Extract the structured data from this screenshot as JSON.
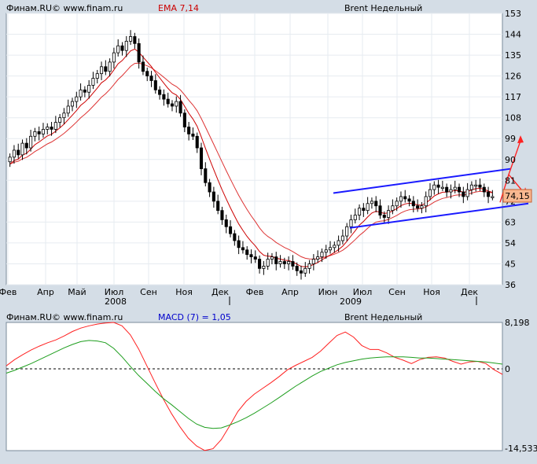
{
  "colors": {
    "background": "#d4dde6",
    "plot_bg": "#ffffff",
    "candle_up": "#ffffff",
    "candle_down": "#000000",
    "ema_fast": "#cc0000",
    "ema_slow": "#dd3333",
    "channel": "#1a1aff",
    "forecast": "#ff2222",
    "price_tag": "#f8b890",
    "macd_line": "#ff2020",
    "signal_line": "#1e9e1e",
    "grid": "#e6ebf0",
    "ema_label": "#cc0000",
    "macd_label": "#0000cc"
  },
  "chart_data": [
    {
      "type": "candlestick",
      "header": {
        "source": "Финам.RU© www.finam.ru",
        "indicator": "EMA 7,14",
        "title": "Brent Недельный"
      },
      "ylim": [
        36,
        153
      ],
      "y_ticks": [
        "153",
        "144",
        "135",
        "126",
        "117",
        "108",
        "99",
        "90",
        "81",
        "72",
        "63",
        "54",
        "45",
        "36"
      ],
      "x_ticks": [
        "Фев",
        "Апр",
        "Май",
        "Июл",
        "Сен",
        "Ноя",
        "Дек",
        "Фев",
        "Апр",
        "Июн",
        "Июл",
        "Сен",
        "Ноя",
        "Дек"
      ],
      "year_labels": [
        "2008",
        "2009"
      ],
      "last_price_label": "74,15",
      "close_series": [
        91,
        94,
        92,
        97,
        95,
        100,
        102,
        101,
        103,
        104,
        103,
        106,
        108,
        110,
        113,
        115,
        117,
        120,
        119,
        122,
        125,
        127,
        130,
        128,
        132,
        136,
        139,
        137,
        141,
        143,
        140,
        132,
        128,
        126,
        124,
        120,
        118,
        116,
        114,
        113,
        115,
        110,
        104,
        101,
        100,
        95,
        86,
        80,
        76,
        72,
        68,
        64,
        61,
        58,
        55,
        52,
        51,
        49,
        48,
        47,
        43,
        44,
        47,
        48,
        45,
        46,
        45,
        46,
        44,
        42,
        41,
        43,
        45,
        47,
        48,
        50,
        51,
        52,
        53,
        55,
        57,
        61,
        64,
        66,
        69,
        68,
        71,
        72,
        70,
        66,
        65,
        68,
        70,
        72,
        74,
        73,
        72,
        70,
        69,
        70,
        74,
        77,
        79,
        78,
        78,
        76,
        77,
        78,
        76,
        74,
        77,
        79,
        79,
        78,
        76,
        74,
        74
      ],
      "ema_fast_note": "EMA 7",
      "ema_slow_note": "EMA 14"
    },
    {
      "type": "line",
      "header": {
        "source": "Финам.RU© www.finam.ru",
        "indicator": "MACD (7) = 1,05",
        "title": "Brent Недельный"
      },
      "ylim": [
        -14.533,
        8.198
      ],
      "y_ticks": [
        "8,198",
        "0",
        "-14,533"
      ],
      "series": [
        {
          "key": "macd",
          "values": [
            0.5,
            1.6,
            2.5,
            3.3,
            4.0,
            4.6,
            5.1,
            5.8,
            6.6,
            7.2,
            7.6,
            7.9,
            8.1,
            8.2,
            7.6,
            6.0,
            3.5,
            0.5,
            -2.5,
            -5.4,
            -8.0,
            -10.3,
            -12.3,
            -13.7,
            -14.5,
            -14.2,
            -12.6,
            -10.2,
            -7.6,
            -5.8,
            -4.5,
            -3.5,
            -2.5,
            -1.4,
            -0.2,
            0.6,
            1.3,
            2.0,
            3.1,
            4.5,
            5.9,
            6.5,
            5.6,
            4.1,
            3.4,
            3.4,
            2.8,
            2.0,
            1.5,
            0.9,
            1.6,
            2.0,
            2.1,
            1.9,
            1.3,
            0.8,
            1.2,
            1.3,
            0.9,
            -0.2,
            -1.0
          ]
        },
        {
          "key": "signal",
          "values": [
            -0.8,
            -0.3,
            0.3,
            0.9,
            1.6,
            2.3,
            3.0,
            3.7,
            4.3,
            4.8,
            5.0,
            4.9,
            4.6,
            3.6,
            2.1,
            0.4,
            -1.2,
            -2.6,
            -4.0,
            -5.3,
            -6.4,
            -7.6,
            -8.8,
            -9.8,
            -10.4,
            -10.6,
            -10.5,
            -10.0,
            -9.4,
            -8.7,
            -7.9,
            -7.0,
            -6.1,
            -5.1,
            -4.1,
            -3.1,
            -2.2,
            -1.3,
            -0.5,
            0.1,
            0.7,
            1.1,
            1.4,
            1.7,
            1.9,
            2.0,
            2.1,
            2.1,
            2.1,
            2.0,
            1.9,
            1.9,
            1.8,
            1.7,
            1.6,
            1.5,
            1.4,
            1.3,
            1.2,
            1.0,
            0.8
          ]
        }
      ]
    }
  ]
}
